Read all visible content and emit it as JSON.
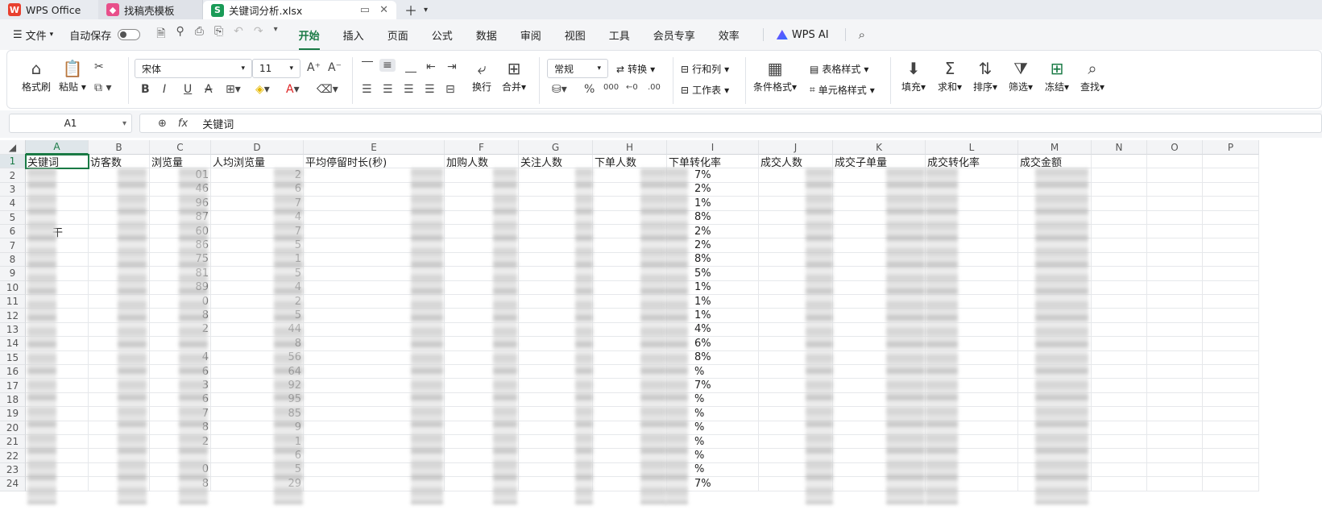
{
  "tabs": {
    "app": "WPS Office",
    "template": "找稿壳模板",
    "file": "关键词分析.xlsx"
  },
  "menu": {
    "file": "文件",
    "autosave": "自动保存",
    "tabs": [
      "开始",
      "插入",
      "页面",
      "公式",
      "数据",
      "审阅",
      "视图",
      "工具",
      "会员专享",
      "效率"
    ],
    "ai": "WPS AI"
  },
  "ribbon": {
    "format_painter": "格式刷",
    "paste": "粘贴",
    "font_name": "宋体",
    "font_size": "11",
    "number_format": "常规",
    "convert": "转换",
    "rows_cols": "行和列",
    "worksheet": "工作表",
    "conditional_format": "条件格式",
    "table_style": "表格样式",
    "cell_style": "单元格样式",
    "wrap": "换行",
    "merge": "合并",
    "fill": "填充",
    "sum": "求和",
    "sort": "排序",
    "filter": "筛选",
    "freeze": "冻结",
    "find": "查找"
  },
  "formula_bar": {
    "name_box": "A1",
    "content": "关键词"
  },
  "sheet": {
    "columns": [
      "A",
      "B",
      "C",
      "D",
      "E",
      "F",
      "G",
      "H",
      "I",
      "J",
      "K",
      "L",
      "M",
      "N",
      "O",
      "P"
    ],
    "headers": [
      "关键词",
      "访客数",
      "浏览量",
      "人均浏览量",
      "平均停留时长(秒)",
      "加购人数",
      "关注人数",
      "下单人数",
      "下单转化率",
      "成交人数",
      "成交子单量",
      "成交转化率",
      "成交金额"
    ],
    "rows": [
      "1",
      "2",
      "3",
      "4",
      "5",
      "6",
      "7",
      "8",
      "9",
      "10",
      "11",
      "12",
      "13",
      "14",
      "15",
      "16",
      "17",
      "18",
      "19",
      "20",
      "21",
      "22",
      "23",
      "24"
    ],
    "visible_fragments": {
      "a6": "干",
      "c": [
        "01",
        "46",
        "96",
        "87",
        "60",
        "86",
        "75",
        "81",
        "89",
        "0",
        "8",
        "2",
        "",
        "4",
        "6",
        "3",
        "6",
        "7",
        "8",
        "2",
        "",
        "0",
        "8"
      ],
      "d": [
        "2",
        "6",
        "7",
        "4",
        "7",
        "5",
        "1",
        "5",
        "4",
        "2",
        "5",
        "44",
        "8",
        "56",
        "64",
        "92",
        "95",
        "85",
        "9",
        "1",
        "6",
        "5",
        "29"
      ],
      "i": [
        "7%",
        "2%",
        "1%",
        "8%",
        "2%",
        "2%",
        "8%",
        "5%",
        "1%",
        "1%",
        "1%",
        "4%",
        "6%",
        "8%",
        "%",
        "7%",
        "%",
        "%",
        "%",
        "%",
        "%",
        "%",
        "7%"
      ]
    }
  }
}
